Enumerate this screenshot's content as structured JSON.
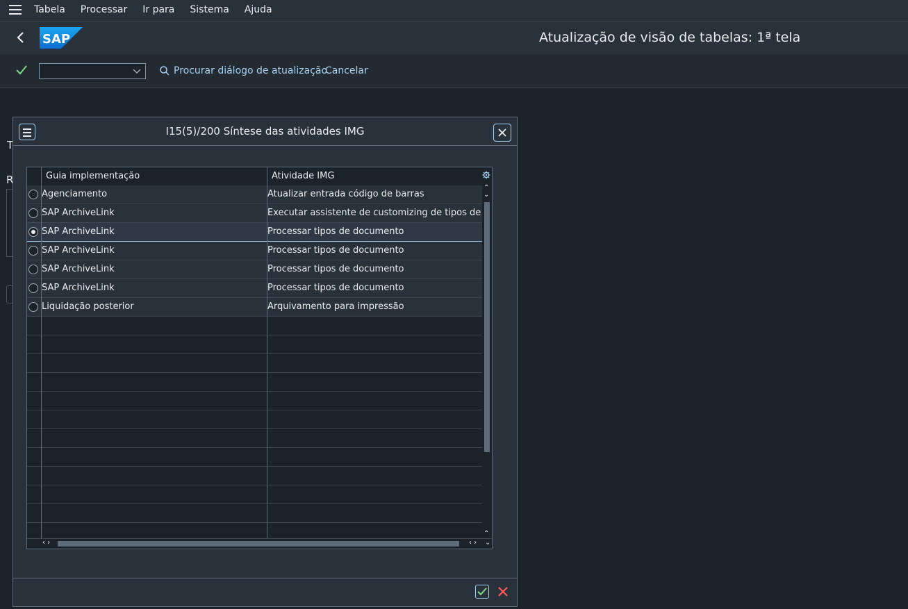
{
  "menubar": {
    "items": [
      "Tabela",
      "Processar",
      "Ir para",
      "Sistema",
      "Ajuda"
    ]
  },
  "shell": {
    "logo_text": "SAP",
    "title": "Atualização de visão de tabelas: 1ª tela"
  },
  "toolbar": {
    "combo_value": "",
    "search_label": "Procurar diálogo de atualização",
    "cancel_label": "Cancelar"
  },
  "background": {
    "fragments": [
      "T",
      "R"
    ]
  },
  "dialog": {
    "title": "I15(5)/200 Síntese das atividades IMG",
    "columns": [
      "Guia implementação",
      "Atividade IMG"
    ],
    "rows": [
      {
        "guide": "Agenciamento",
        "activity": "Atualizar entrada código de barras",
        "selected": false
      },
      {
        "guide": "SAP ArchiveLink",
        "activity": "Executar assistente de customizing de tipos de do...",
        "selected": false
      },
      {
        "guide": "SAP ArchiveLink",
        "activity": "Processar tipos de documento",
        "selected": true
      },
      {
        "guide": "SAP ArchiveLink",
        "activity": "Processar tipos de documento",
        "selected": false
      },
      {
        "guide": "SAP ArchiveLink",
        "activity": "Processar tipos de documento",
        "selected": false
      },
      {
        "guide": "SAP ArchiveLink",
        "activity": "Processar tipos de documento",
        "selected": false
      },
      {
        "guide": "Liquidação posterior",
        "activity": "Arquivamento para impressão",
        "selected": false
      }
    ],
    "empty_rows": 12
  },
  "colors": {
    "accent": "#a8d1f0",
    "ok_green": "#7fd88a",
    "cancel_red": "#ff5a5a"
  }
}
